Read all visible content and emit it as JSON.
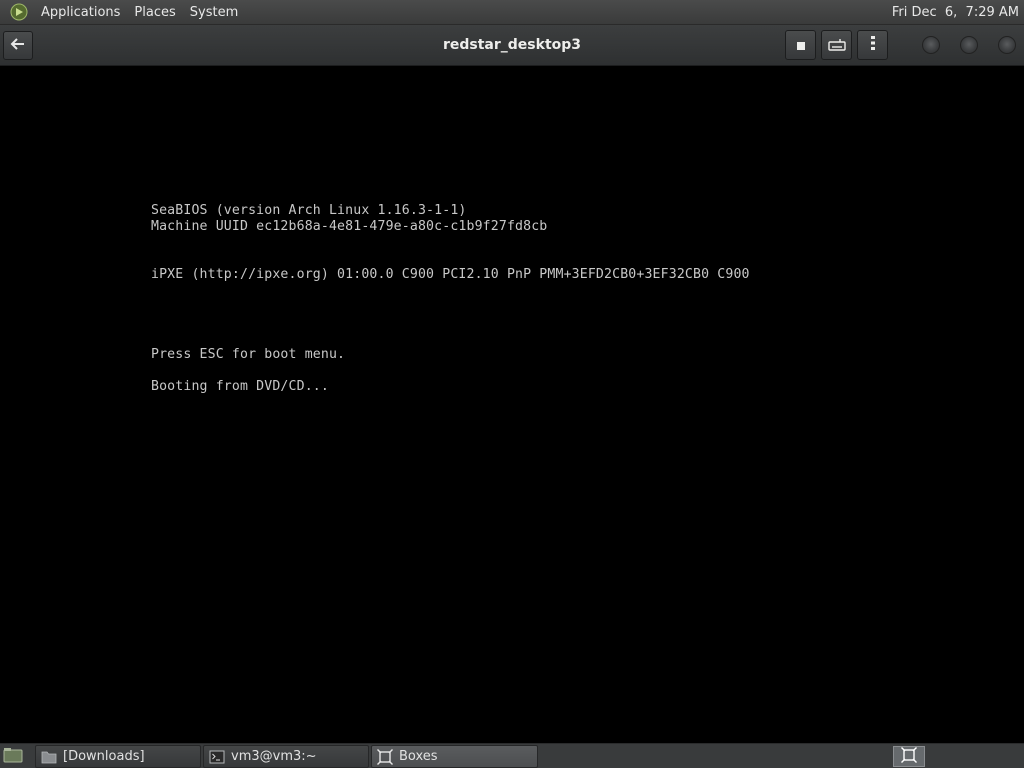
{
  "top_panel": {
    "menus": [
      "Applications",
      "Places",
      "System"
    ],
    "clock": "Fri Dec  6,  7:29 AM"
  },
  "header": {
    "title": "redstar_desktop3",
    "icons": {
      "back": "back-arrow-icon",
      "stop": "stop-icon",
      "keyboard": "keyboard-icon",
      "menu": "vertical-ellipsis-icon"
    }
  },
  "console": {
    "lines": [
      "SeaBIOS (version Arch Linux 1.16.3-1-1)",
      "Machine UUID ec12b68a-4e81-479e-a80c-c1b9f27fd8cb",
      "iPXE (http://ipxe.org) 01:00.0 C900 PCI2.10 PnP PMM+3EFD2CB0+3EF32CB0 C900",
      "Press ESC for boot menu.",
      "Booting from DVD/CD..."
    ]
  },
  "taskbar": {
    "tasks": [
      {
        "label": "[Downloads]",
        "icon": "folder-icon",
        "active": false
      },
      {
        "label": "vm3@vm3:~",
        "icon": "terminal-icon",
        "active": false
      },
      {
        "label": "Boxes",
        "icon": "boxes-icon",
        "active": true
      }
    ]
  },
  "colors": {
    "panel_bg": "#3a3b3b",
    "console_bg": "#000000",
    "console_text": "#c8c8c8",
    "header_bg": "#2e3031"
  }
}
